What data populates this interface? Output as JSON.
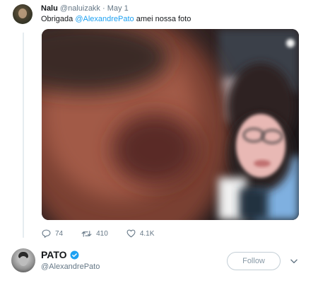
{
  "tweet": {
    "author_name": "Nalu",
    "author_handle": "@naluizakk",
    "separator": "·",
    "date": "May 1",
    "text_before": "Obrigada ",
    "mention": "@AlexandrePato",
    "text_after": " amei nossa foto",
    "actions": {
      "replies": "74",
      "retweets": "410",
      "likes": "4.1K"
    }
  },
  "profile": {
    "name": "PATO",
    "handle": "@AlexandrePato",
    "follow_label": "Follow",
    "verified": true
  },
  "colors": {
    "accent": "#1da1f2",
    "muted": "#657786",
    "text": "#14171a"
  },
  "icons": {
    "reply": "reply-icon",
    "retweet": "retweet-icon",
    "like": "heart-icon",
    "verified": "verified-badge-icon",
    "more": "chevron-down-icon"
  }
}
